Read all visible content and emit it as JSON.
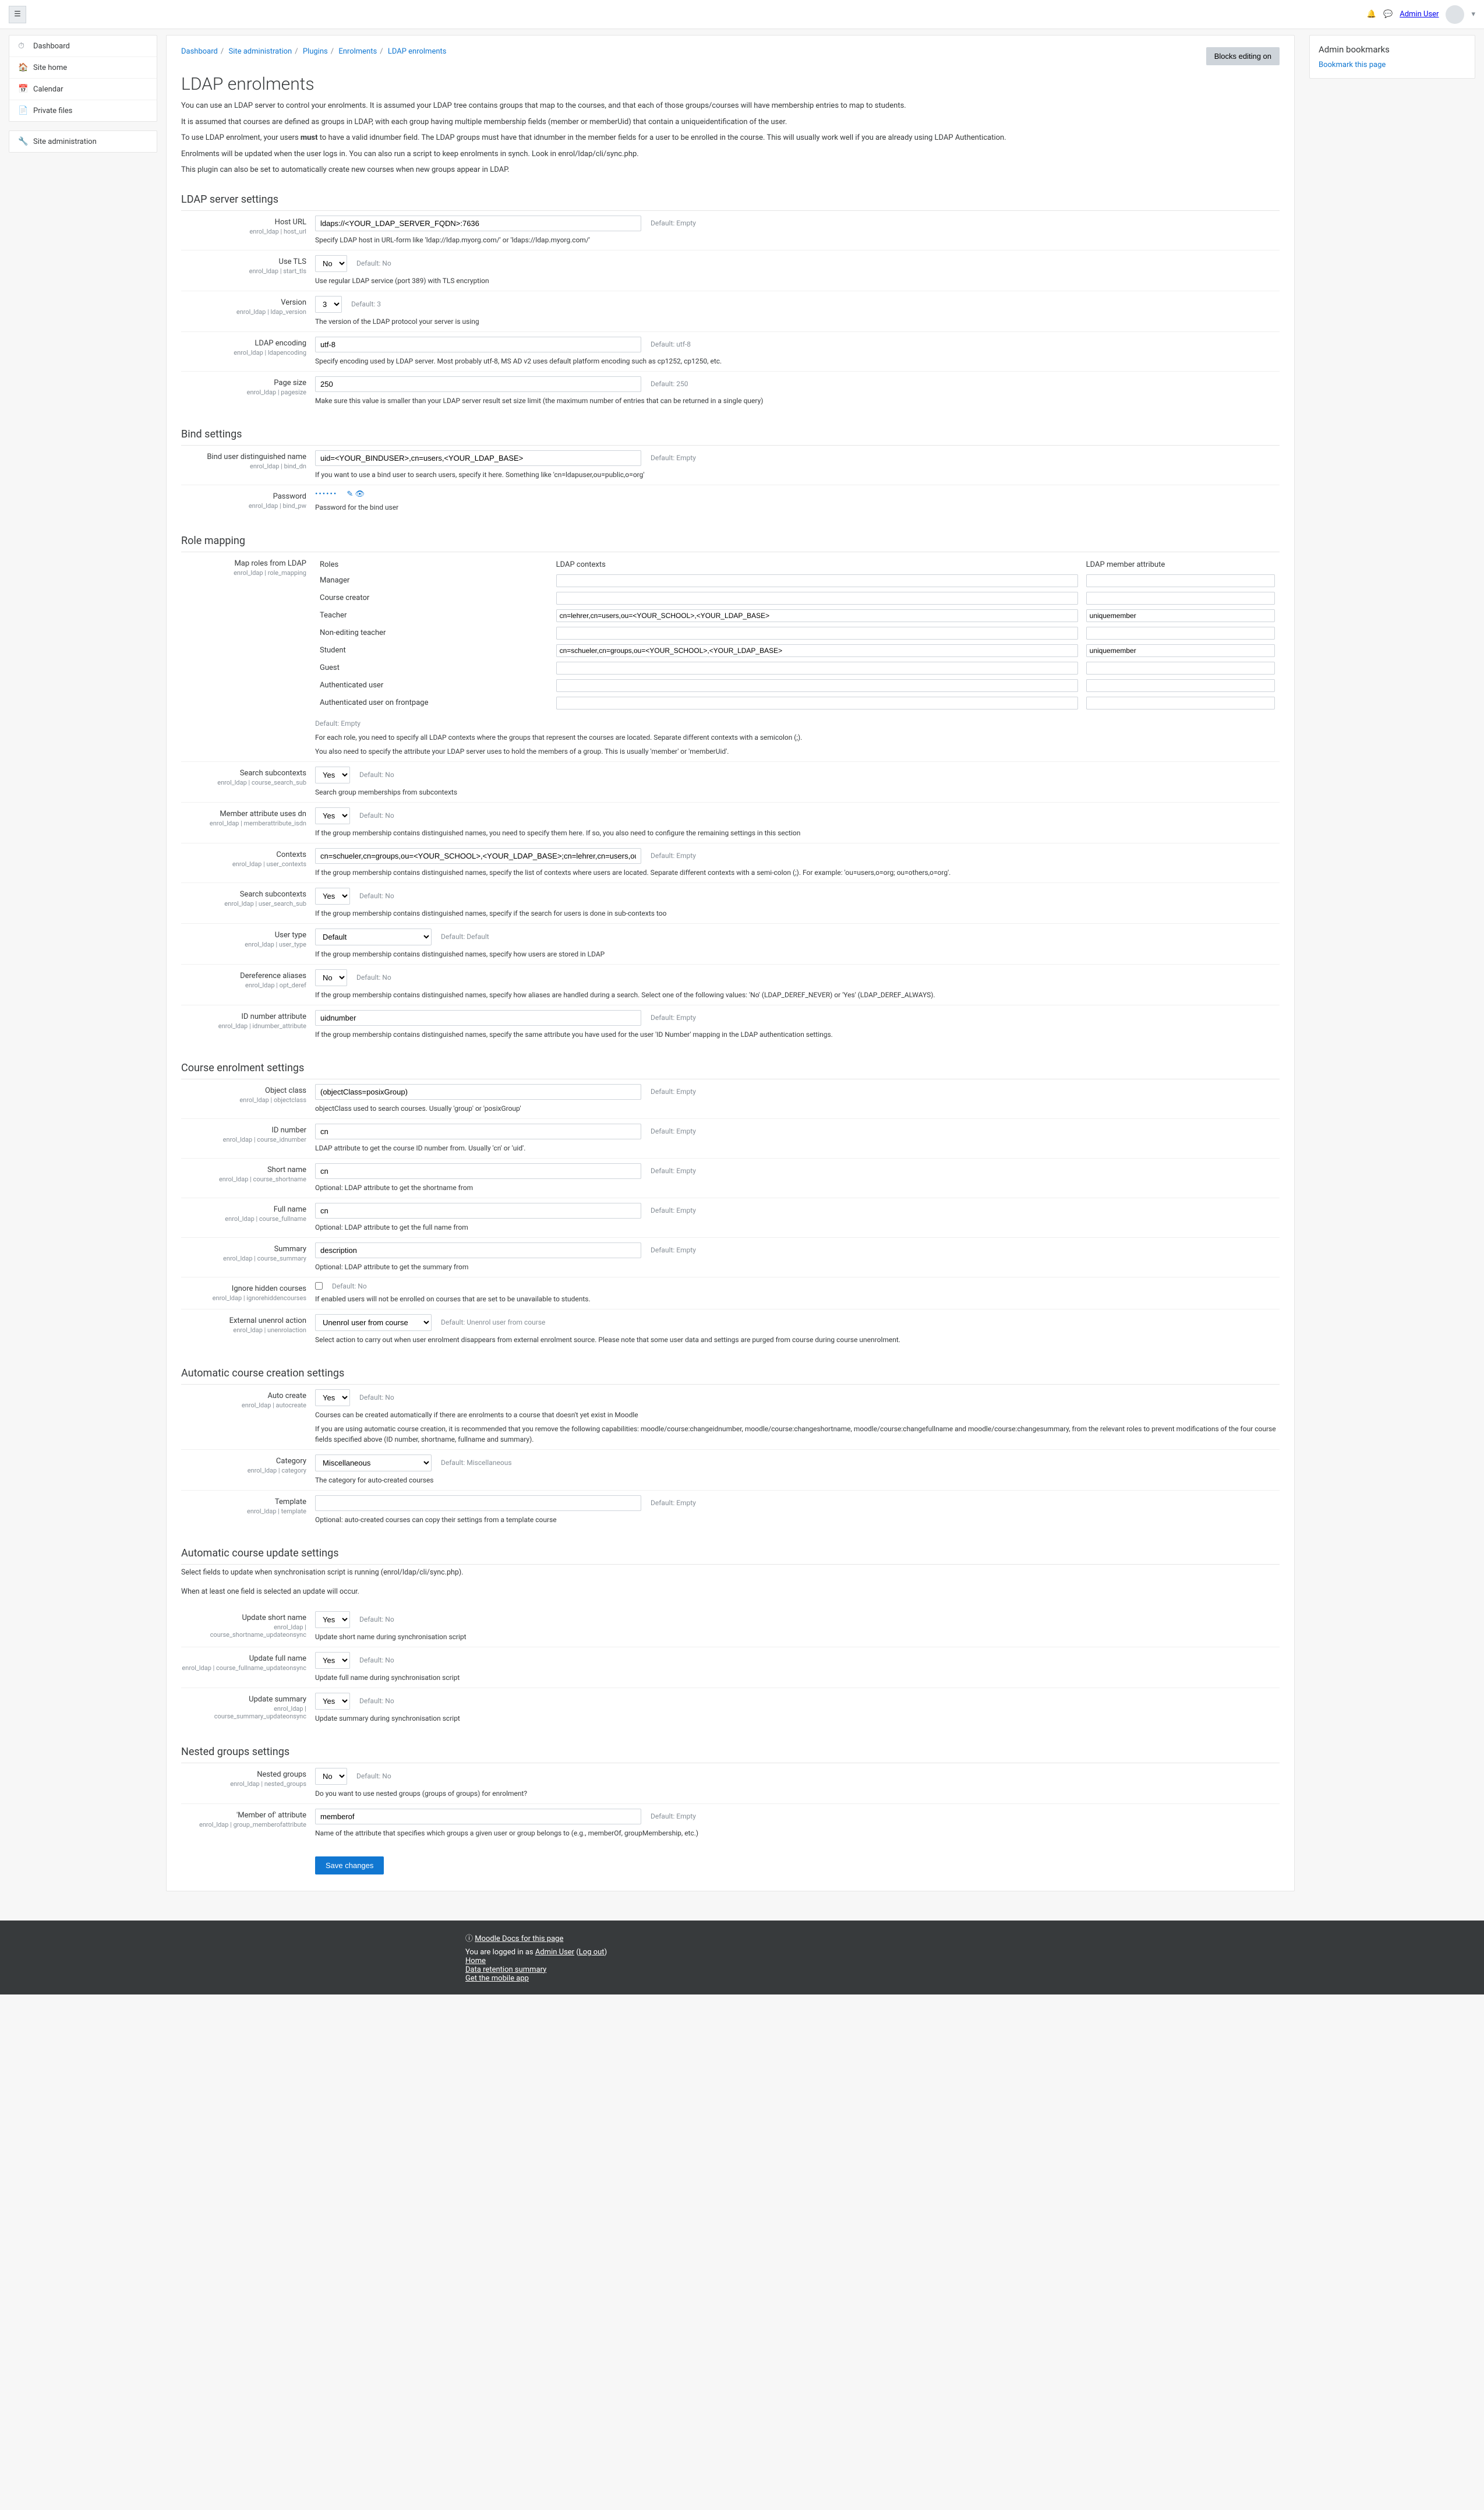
{
  "topbar": {
    "user_label": "Admin User"
  },
  "sidebar": {
    "items": [
      {
        "icon": "⏱",
        "label": "Dashboard"
      },
      {
        "icon": "🏠",
        "label": "Site home"
      },
      {
        "icon": "📅",
        "label": "Calendar"
      },
      {
        "icon": "📄",
        "label": "Private files"
      }
    ],
    "admin": {
      "icon": "🔧",
      "label": "Site administration"
    }
  },
  "breadcrumb": [
    "Dashboard",
    "Site administration",
    "Plugins",
    "Enrolments",
    "LDAP enrolments"
  ],
  "editing_btn": "Blocks editing on",
  "aside": {
    "title": "Admin bookmarks",
    "link": "Bookmark this page"
  },
  "page": {
    "title": "LDAP enrolments",
    "intro": [
      "You can use an LDAP server to control your enrolments. It is assumed your LDAP tree contains groups that map to the courses, and that each of those groups/courses will have membership entries to map to students.",
      "It is assumed that courses are defined as groups in LDAP, with each group having multiple membership fields (member or memberUid) that contain a uniqueidentification of the user.",
      "To use LDAP enrolment, your users must to have a valid idnumber field. The LDAP groups must have that idnumber in the member fields for a user to be enrolled in the course. This will usually work well if you are already using LDAP Authentication.",
      "Enrolments will be updated when the user logs in. You can also run a script to keep enrolments in synch. Look in enrol/ldap/cli/sync.php.",
      "This plugin can also be set to automatically create new courses when new groups appear in LDAP."
    ]
  },
  "sections": {
    "ldap_server": "LDAP server settings",
    "bind": "Bind settings",
    "role_mapping": "Role mapping",
    "course_enrol": "Course enrolment settings",
    "auto_create": "Automatic course creation settings",
    "auto_update": "Automatic course update settings",
    "nested": "Nested groups settings"
  },
  "fields": {
    "host_url": {
      "label": "Host URL",
      "key": "enrol_ldap | host_url",
      "value": "ldaps://<YOUR_LDAP_SERVER_FQDN>:7636",
      "default": "Default: Empty",
      "help": "Specify LDAP host in URL-form like 'ldap://ldap.myorg.com/' or 'ldaps://ldap.myorg.com/'"
    },
    "start_tls": {
      "label": "Use TLS",
      "key": "enrol_ldap | start_tls",
      "value": "No",
      "default": "Default: No",
      "help": "Use regular LDAP service (port 389) with TLS encryption"
    },
    "ldap_version": {
      "label": "Version",
      "key": "enrol_ldap | ldap_version",
      "value": "3",
      "default": "Default: 3",
      "help": "The version of the LDAP protocol your server is using"
    },
    "ldap_encoding": {
      "label": "LDAP encoding",
      "key": "enrol_ldap | ldapencoding",
      "value": "utf-8",
      "default": "Default: utf-8",
      "help": "Specify encoding used by LDAP server. Most probably utf-8, MS AD v2 uses default platform encoding such as cp1252, cp1250, etc."
    },
    "pagesize": {
      "label": "Page size",
      "key": "enrol_ldap | pagesize",
      "value": "250",
      "default": "Default: 250",
      "help": "Make sure this value is smaller than your LDAP server result set size limit (the maximum number of entries that can be returned in a single query)"
    },
    "bind_dn": {
      "label": "Bind user distinguished name",
      "key": "enrol_ldap | bind_dn",
      "value": "uid=<YOUR_BINDUSER>,cn=users,<YOUR_LDAP_BASE>",
      "default": "Default: Empty",
      "help": "If you want to use a bind user to search users, specify it here. Something like 'cn=ldapuser,ou=public,o=org'"
    },
    "bind_pw": {
      "label": "Password",
      "key": "enrol_ldap | bind_pw",
      "mask": "••••••",
      "help": "Password for the bind user"
    },
    "role_map": {
      "label": "Map roles from LDAP",
      "key": "enrol_ldap | role_mapping",
      "headers": [
        "Roles",
        "LDAP contexts",
        "LDAP member attribute"
      ],
      "rows": [
        {
          "role": "Manager",
          "ctx": "",
          "attr": ""
        },
        {
          "role": "Course creator",
          "ctx": "",
          "attr": ""
        },
        {
          "role": "Teacher",
          "ctx": "cn=lehrer,cn=users,ou=<YOUR_SCHOOL>,<YOUR_LDAP_BASE>",
          "attr": "uniquemember"
        },
        {
          "role": "Non-editing teacher",
          "ctx": "",
          "attr": ""
        },
        {
          "role": "Student",
          "ctx": "cn=schueler,cn=groups,ou=<YOUR_SCHOOL>,<YOUR_LDAP_BASE>",
          "attr": "uniquemember"
        },
        {
          "role": "Guest",
          "ctx": "",
          "attr": ""
        },
        {
          "role": "Authenticated user",
          "ctx": "",
          "attr": ""
        },
        {
          "role": "Authenticated user on frontpage",
          "ctx": "",
          "attr": ""
        }
      ],
      "default": "Default: Empty",
      "help1": "For each role, you need to specify all LDAP contexts where the groups that represent the courses are located. Separate different contexts with a semicolon (;).",
      "help2": "You also need to specify the attribute your LDAP server uses to hold the members of a group. This is usually 'member' or 'memberUid'."
    },
    "course_search_sub": {
      "label": "Search subcontexts",
      "key": "enrol_ldap | course_search_sub",
      "value": "Yes",
      "default": "Default: No",
      "help": "Search group memberships from subcontexts"
    },
    "memberattribute_isdn": {
      "label": "Member attribute uses dn",
      "key": "enrol_ldap | memberattribute_isdn",
      "value": "Yes",
      "default": "Default: No",
      "help": "If the group membership contains distinguished names, you need to specify them here. If so, you also need to configure the remaining settings in this section"
    },
    "user_contexts": {
      "label": "Contexts",
      "key": "enrol_ldap | user_contexts",
      "value": "cn=schueler,cn=groups,ou=<YOUR_SCHOOL>,<YOUR_LDAP_BASE>;cn=lehrer,cn=users,ou=<YOUR_SCHOOL>,<YOUR_LDAP_BASE>",
      "default": "Default: Empty",
      "help": "If the group membership contains distinguished names, specify the list of contexts where users are located. Separate different contexts with a semi-colon (;). For example: 'ou=users,o=org; ou=others,o=org'."
    },
    "user_search_sub": {
      "label": "Search subcontexts",
      "key": "enrol_ldap | user_search_sub",
      "value": "Yes",
      "default": "Default: No",
      "help": "If the group membership contains distinguished names, specify if the search for users is done in sub-contexts too"
    },
    "user_type": {
      "label": "User type",
      "key": "enrol_ldap | user_type",
      "value": "Default",
      "default": "Default: Default",
      "help": "If the group membership contains distinguished names, specify how users are stored in LDAP"
    },
    "opt_deref": {
      "label": "Dereference aliases",
      "key": "enrol_ldap | opt_deref",
      "value": "No",
      "default": "Default: No",
      "help": "If the group membership contains distinguished names, specify how aliases are handled during a search. Select one of the following values: 'No' (LDAP_DEREF_NEVER) or 'Yes' (LDAP_DEREF_ALWAYS)."
    },
    "idnumber_attribute": {
      "label": "ID number attribute",
      "key": "enrol_ldap | idnumber_attribute",
      "value": "uidnumber",
      "default": "Default: Empty",
      "help": "If the group membership contains distinguished names, specify the same attribute you have used for the user 'ID Number' mapping in the LDAP authentication settings."
    },
    "objectclass": {
      "label": "Object class",
      "key": "enrol_ldap | objectclass",
      "value": "(objectClass=posixGroup)",
      "default": "Default: Empty",
      "help": "objectClass used to search courses. Usually 'group' or 'posixGroup'"
    },
    "course_idnumber": {
      "label": "ID number",
      "key": "enrol_ldap | course_idnumber",
      "value": "cn",
      "default": "Default: Empty",
      "help": "LDAP attribute to get the course ID number from. Usually 'cn' or 'uid'."
    },
    "course_shortname": {
      "label": "Short name",
      "key": "enrol_ldap | course_shortname",
      "value": "cn",
      "default": "Default: Empty",
      "help": "Optional: LDAP attribute to get the shortname from"
    },
    "course_fullname": {
      "label": "Full name",
      "key": "enrol_ldap | course_fullname",
      "value": "cn",
      "default": "Default: Empty",
      "help": "Optional: LDAP attribute to get the full name from"
    },
    "course_summary": {
      "label": "Summary",
      "key": "enrol_ldap | course_summary",
      "value": "description",
      "default": "Default: Empty",
      "help": "Optional: LDAP attribute to get the summary from"
    },
    "ignorehidden": {
      "label": "Ignore hidden courses",
      "key": "enrol_ldap | ignorehiddencourses",
      "default": "Default: No",
      "help": "If enabled users will not be enrolled on courses that are set to be unavailable to students."
    },
    "unenrolaction": {
      "label": "External unenrol action",
      "key": "enrol_ldap | unenrolaction",
      "value": "Unenrol user from course",
      "default": "Default: Unenrol user from course",
      "help": "Select action to carry out when user enrolment disappears from external enrolment source. Please note that some user data and settings are purged from course during course unenrolment."
    },
    "autocreate": {
      "label": "Auto create",
      "key": "enrol_ldap | autocreate",
      "value": "Yes",
      "default": "Default: No",
      "help1": "Courses can be created automatically if there are enrolments to a course that doesn't yet exist in Moodle",
      "help2": "If you are using automatic course creation, it is recommended that you remove the following capabilities: moodle/course:changeidnumber, moodle/course:changeshortname, moodle/course:changefullname and moodle/course:changesummary, from the relevant roles to prevent modifications of the four course fields specified above (ID number, shortname, fullname and summary)."
    },
    "category": {
      "label": "Category",
      "key": "enrol_ldap | category",
      "value": "Miscellaneous",
      "default": "Default: Miscellaneous",
      "help": "The category for auto-created courses"
    },
    "template": {
      "label": "Template",
      "key": "enrol_ldap | template",
      "value": "",
      "default": "Default: Empty",
      "help": "Optional: auto-created courses can copy their settings from a template course"
    },
    "update_intro": "Select fields to update when synchronisation script is running (enrol/ldap/cli/sync.php).",
    "update_intro2": "When at least one field is selected an update will occur.",
    "upd_shortname": {
      "label": "Update short name",
      "key": "enrol_ldap | course_shortname_updateonsync",
      "value": "Yes",
      "default": "Default: No",
      "help": "Update short name during synchronisation script"
    },
    "upd_fullname": {
      "label": "Update full name",
      "key": "enrol_ldap | course_fullname_updateonsync",
      "value": "Yes",
      "default": "Default: No",
      "help": "Update full name during synchronisation script"
    },
    "upd_summary": {
      "label": "Update summary",
      "key": "enrol_ldap | course_summary_updateonsync",
      "value": "Yes",
      "default": "Default: No",
      "help": "Update summary during synchronisation script"
    },
    "nested_groups": {
      "label": "Nested groups",
      "key": "enrol_ldap | nested_groups",
      "value": "No",
      "default": "Default: No",
      "help": "Do you want to use nested groups (groups of groups) for enrolment?"
    },
    "member_attr": {
      "label": "'Member of' attribute",
      "key": "enrol_ldap | group_memberofattribute",
      "value": "memberof",
      "default": "Default: Empty",
      "help": "Name of the attribute that specifies which groups a given user or group belongs to (e.g., memberOf, groupMembership, etc.)"
    }
  },
  "save_btn": "Save changes",
  "footer": {
    "docs_icon": "ⓘ",
    "docs": "Moodle Docs for this page",
    "logged_prefix": "You are logged in as ",
    "logged_user": "Admin User",
    "logout": "Log out",
    "links": [
      "Home",
      "Data retention summary",
      "Get the mobile app"
    ]
  }
}
